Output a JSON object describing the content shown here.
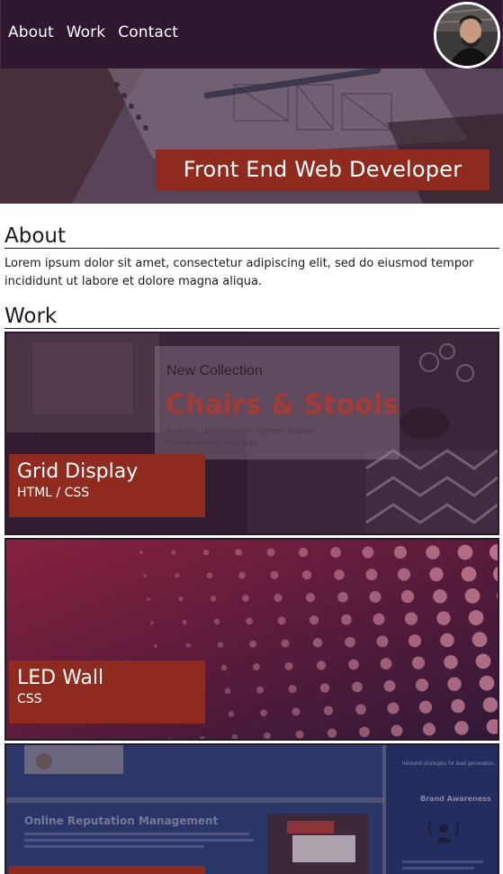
{
  "nav": {
    "items": [
      {
        "label": "About"
      },
      {
        "label": "Work"
      },
      {
        "label": "Contact"
      }
    ]
  },
  "hero": {
    "title": "Front End Web Developer"
  },
  "about": {
    "heading": "About",
    "text": "Lorem ipsum dolor sit amet, consectetur adipiscing elit, sed do eiusmod tempor incididunt ut labore et dolore magna aliqua."
  },
  "work": {
    "heading": "Work",
    "items": [
      {
        "title": "Grid Display",
        "tech": "HTML / CSS",
        "preview": {
          "kicker": "New Collection",
          "headline": "Chairs & Stools",
          "line1": "Armchair upholstered in synthetic leather.",
          "line2": "Powder coated steel legs."
        }
      },
      {
        "title": "LED Wall",
        "tech": "CSS"
      },
      {
        "title": "",
        "tech": "",
        "preview": {
          "headline": "Online Reputation Management",
          "side_text": "Inbound strategies for lead generation require less work for your business, bringing customers directly to your website.",
          "side_heading": "Brand Awareness"
        }
      }
    ]
  },
  "colors": {
    "header_bg": "#2f1730",
    "accent": "#8e2a1e",
    "card_border": "#2a1631",
    "text": "#1d1820"
  }
}
